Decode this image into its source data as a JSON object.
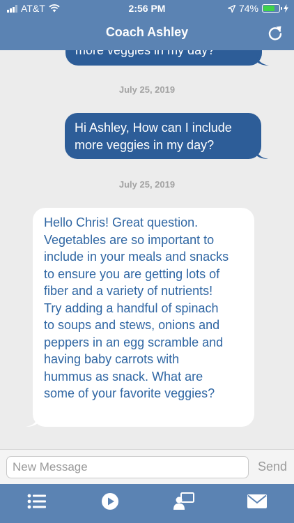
{
  "status_bar": {
    "carrier": "AT&T",
    "time": "2:56 PM",
    "battery": "74%",
    "battery_level": 0.74
  },
  "header": {
    "title": "Coach Ashley",
    "refresh_icon": "refresh-icon"
  },
  "messages": [
    {
      "type": "outgoing",
      "text": "more veggies in my day?"
    },
    {
      "type": "date",
      "text": "July 25, 2019"
    },
    {
      "type": "outgoing",
      "lines": [
        "Hi Ashley, How can I include",
        "more veggies in my day?"
      ]
    },
    {
      "type": "date",
      "text": "July 25, 2019"
    },
    {
      "type": "incoming",
      "lines": [
        "Hello Chris! Great question.",
        "Vegetables are so important to",
        "include in your meals and snacks",
        "to ensure you are getting lots of",
        "fiber and a variety of nutrients!",
        "Try adding a handful of spinach",
        "to soups and stews, onions and",
        "peppers in an egg scramble and",
        "having baby carrots with",
        "hummus as snack. What are",
        "some of your favorite veggies?"
      ]
    }
  ],
  "composer": {
    "placeholder": "New Message",
    "value": "",
    "send_label": "Send"
  },
  "tabbar": {
    "items": [
      "list-icon",
      "play-icon",
      "coach-icon",
      "mail-icon"
    ]
  },
  "colors": {
    "header": "#5b83b3",
    "outgoing_bubble": "#2d5d98",
    "incoming_text": "#2f66a3",
    "background": "#ececec"
  }
}
